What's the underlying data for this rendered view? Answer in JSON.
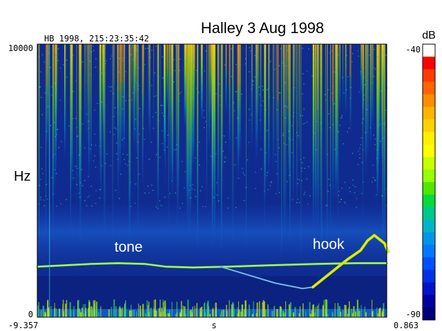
{
  "chart_data": {
    "type": "heatmap",
    "title": "Halley 3 Aug 1998",
    "header_text": "HB 1998, 215:23:35:42",
    "xlabel": "s",
    "ylabel": "Hz",
    "x_tick_labels": [
      "-9.357",
      "0.863"
    ],
    "y_tick_labels": [
      "10000",
      "0"
    ],
    "xlim": [
      -9.357,
      0.863
    ],
    "ylim": [
      0,
      10000
    ],
    "colorbar": {
      "label": "dB",
      "range": [
        -90,
        -40
      ],
      "tick_labels": [
        "-40",
        "-90"
      ],
      "colors": [
        "#ffffff",
        "#ff0000",
        "#ff3c00",
        "#ff6400",
        "#ff8c00",
        "#ffb400",
        "#ffd200",
        "#fff000",
        "#ffff00",
        "#c8ff00",
        "#96ff00",
        "#50e600",
        "#00dc3c",
        "#00c88c",
        "#00b4c8",
        "#0096e6",
        "#0078ff",
        "#0050ff",
        "#0032e6",
        "#0014c8",
        "#0000a0",
        "#000078"
      ]
    },
    "annotations": [
      {
        "text": "tone",
        "x": -7.1,
        "y": 2400
      },
      {
        "text": "hook",
        "x": -1.3,
        "y": 2500
      }
    ],
    "features": {
      "tone": [
        [
          -9.357,
          1850
        ],
        [
          -7.8,
          1950
        ],
        [
          -7.0,
          1980
        ],
        [
          -6.2,
          1950
        ],
        [
          -5.6,
          1850
        ],
        [
          -4.8,
          1820
        ],
        [
          -3.8,
          1850
        ],
        [
          -2.6,
          1900
        ],
        [
          -1.2,
          1950
        ],
        [
          0.0,
          1980
        ],
        [
          0.863,
          1980
        ]
      ],
      "dip": [
        [
          -4.0,
          1850
        ],
        [
          -3.2,
          1550
        ],
        [
          -2.4,
          1250
        ],
        [
          -1.6,
          1050
        ],
        [
          -1.3,
          1100
        ]
      ],
      "hook": [
        [
          -1.3,
          1100
        ],
        [
          -0.8,
          1600
        ],
        [
          -0.3,
          2100
        ],
        [
          0.1,
          2450
        ],
        [
          0.3,
          2800
        ],
        [
          0.5,
          3000
        ],
        [
          0.8,
          2700
        ],
        [
          0.9,
          2400
        ]
      ]
    }
  }
}
